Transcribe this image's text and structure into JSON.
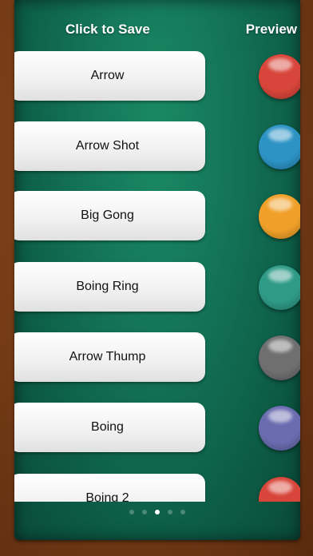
{
  "header": {
    "save_label": "Click to Save",
    "preview_label": "Preview"
  },
  "sounds": [
    {
      "label": "Arrow",
      "color": "#d8453a"
    },
    {
      "label": "Arrow Shot",
      "color": "#2c93c4"
    },
    {
      "label": "Big Gong",
      "color": "#f0a028"
    },
    {
      "label": "Boing Ring",
      "color": "#2f9a86"
    },
    {
      "label": "Arrow Thump",
      "color": "#6f6f6f"
    },
    {
      "label": "Boing",
      "color": "#6a6cb0"
    },
    {
      "label": "Boing 2",
      "color": "#d8453a"
    }
  ],
  "pager": {
    "pages": 5,
    "active": 3
  }
}
